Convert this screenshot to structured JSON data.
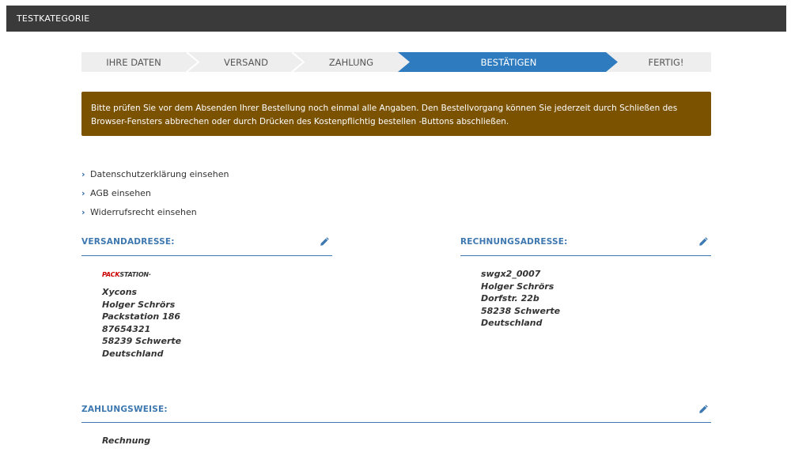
{
  "header": {
    "title": "TESTKATEGORIE"
  },
  "steps": [
    {
      "label": "IHRE DATEN",
      "active": false
    },
    {
      "label": "VERSAND",
      "active": false
    },
    {
      "label": "ZAHLUNG",
      "active": false
    },
    {
      "label": "BESTÄTIGEN",
      "active": true
    },
    {
      "label": "FERTIG!",
      "active": false
    }
  ],
  "notice": {
    "text": "Bitte prüfen Sie vor dem Absenden Ihrer Bestellung noch einmal alle Angaben. Den Bestellvorgang können Sie jederzeit durch Schließen des Browser-Fensters abbrechen oder durch Drücken des Kostenpflichtig bestellen -Buttons abschließen."
  },
  "links": [
    {
      "label": "Datenschutzerklärung einsehen"
    },
    {
      "label": "AGB einsehen"
    },
    {
      "label": "Widerrufsrecht einsehen"
    }
  ],
  "shipping": {
    "title": "VERSANDADRESSE:",
    "logo": {
      "part1": "PACK",
      "part2": "STATION",
      "mark": "·"
    },
    "lines": [
      "Xycons",
      "Holger Schrörs",
      "Packstation 186",
      "87654321",
      "58239 Schwerte",
      "Deutschland"
    ]
  },
  "billing": {
    "title": "RECHNUNGSADRESSE:",
    "lines": [
      "swgx2_0007",
      "Holger Schrörs",
      "Dorfstr. 22b",
      "58238 Schwerte",
      "Deutschland"
    ]
  },
  "payment": {
    "title": "ZAHLUNGSWEISE:",
    "method": "Rechnung"
  },
  "colors": {
    "topbar": "#3a3a3a",
    "step_bg": "#eeeeee",
    "step_active": "#2e7bbf",
    "notice_bg": "#7a5200",
    "accent": "#3d78b0"
  },
  "icons": {
    "edit": "pencil-icon",
    "link": "chevron-right-icon"
  }
}
